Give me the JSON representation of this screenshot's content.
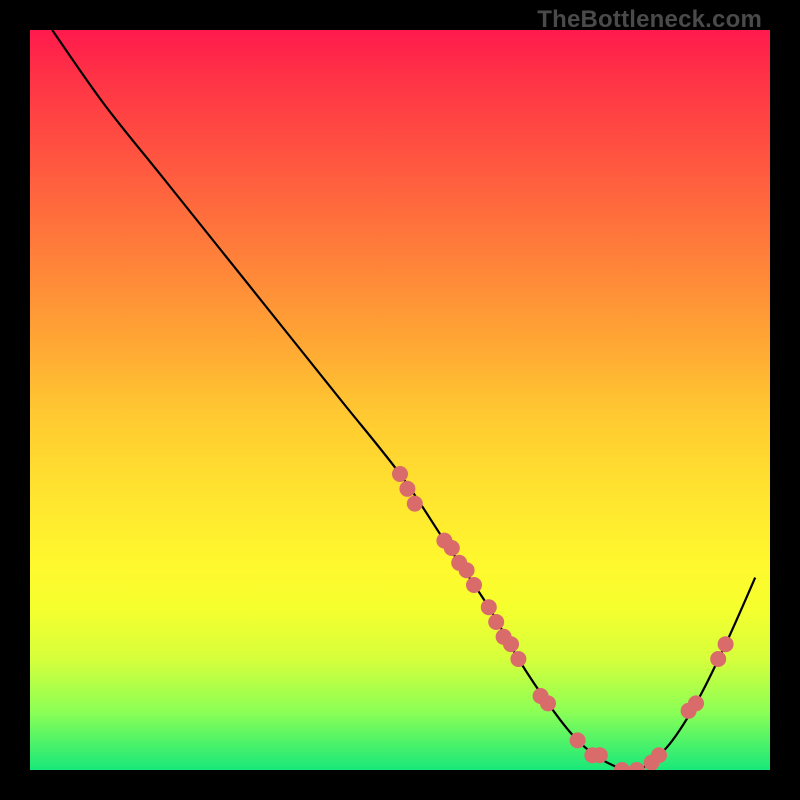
{
  "watermark": "TheBottleneck.com",
  "colors": {
    "curve_stroke": "#000000",
    "marker_fill": "#d96b6b",
    "marker_stroke": "#c85a5a"
  },
  "chart_data": {
    "type": "line",
    "title": "",
    "xlabel": "",
    "ylabel": "",
    "xlim": [
      0,
      100
    ],
    "ylim": [
      0,
      100
    ],
    "grid": false,
    "series": [
      {
        "name": "bottleneck-curve",
        "x": [
          3,
          10,
          18,
          26,
          34,
          42,
          50,
          56,
          62,
          66,
          70,
          74,
          78,
          82,
          86,
          90,
          94,
          98
        ],
        "y": [
          100,
          90,
          80,
          70,
          60,
          50,
          40,
          31,
          22,
          15,
          9,
          4,
          1,
          0,
          3,
          9,
          17,
          26
        ]
      }
    ],
    "markers": [
      {
        "x": 50,
        "y": 40
      },
      {
        "x": 51,
        "y": 38
      },
      {
        "x": 52,
        "y": 36
      },
      {
        "x": 56,
        "y": 31
      },
      {
        "x": 57,
        "y": 30
      },
      {
        "x": 58,
        "y": 28
      },
      {
        "x": 59,
        "y": 27
      },
      {
        "x": 60,
        "y": 25
      },
      {
        "x": 62,
        "y": 22
      },
      {
        "x": 63,
        "y": 20
      },
      {
        "x": 64,
        "y": 18
      },
      {
        "x": 65,
        "y": 17
      },
      {
        "x": 66,
        "y": 15
      },
      {
        "x": 69,
        "y": 10
      },
      {
        "x": 70,
        "y": 9
      },
      {
        "x": 74,
        "y": 4
      },
      {
        "x": 76,
        "y": 2
      },
      {
        "x": 77,
        "y": 2
      },
      {
        "x": 80,
        "y": 0
      },
      {
        "x": 82,
        "y": 0
      },
      {
        "x": 84,
        "y": 1
      },
      {
        "x": 85,
        "y": 2
      },
      {
        "x": 89,
        "y": 8
      },
      {
        "x": 90,
        "y": 9
      },
      {
        "x": 93,
        "y": 15
      },
      {
        "x": 94,
        "y": 17
      }
    ]
  }
}
